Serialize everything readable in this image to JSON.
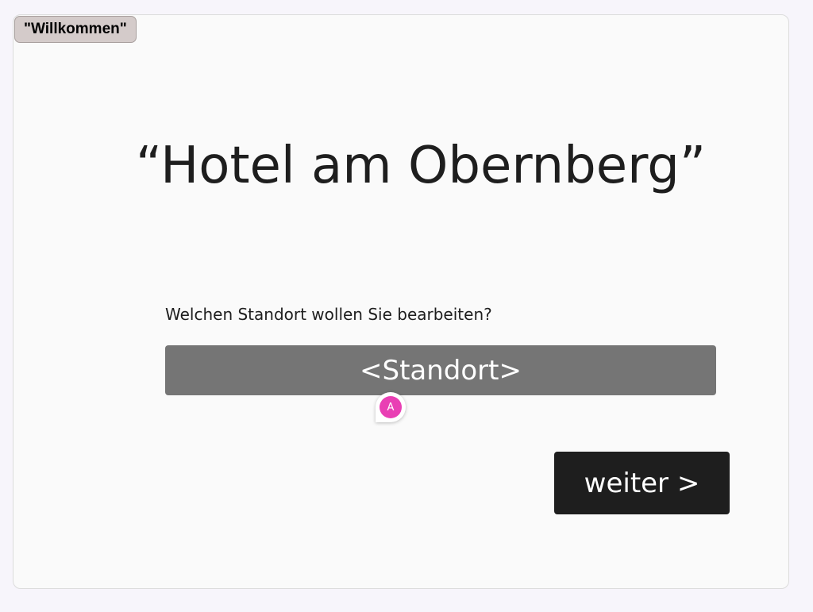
{
  "frame": {
    "tag_label": "\"Willkommen\""
  },
  "main": {
    "title": "“Hotel am Obernberg”",
    "question": "Welchen Standort wollen Sie bearbeiten?",
    "location_field": "<Standort>",
    "next_button": "weiter >"
  },
  "comment": {
    "avatar_initial": "A",
    "avatar_color": "#e93fb4"
  },
  "colors": {
    "background": "#f7f5fb",
    "frame": "#fafafa",
    "field": "#757575",
    "button": "#1e1e1e",
    "tag": "#d4cbca"
  }
}
